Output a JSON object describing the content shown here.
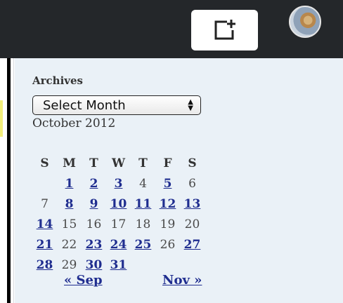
{
  "topbar": {
    "new_post_icon": "new-post-icon",
    "avatar_icon": "user-avatar"
  },
  "archives": {
    "title": "Archives",
    "select_value": "Select Month"
  },
  "calendar": {
    "caption": "October 2012",
    "weekdays": [
      "S",
      "M",
      "T",
      "W",
      "T",
      "F",
      "S"
    ],
    "rows": [
      [
        null,
        {
          "d": "1",
          "link": true
        },
        {
          "d": "2",
          "link": true
        },
        {
          "d": "3",
          "link": true
        },
        {
          "d": "4",
          "link": false
        },
        {
          "d": "5",
          "link": true
        },
        {
          "d": "6",
          "link": false
        }
      ],
      [
        {
          "d": "7",
          "link": false
        },
        {
          "d": "8",
          "link": true
        },
        {
          "d": "9",
          "link": true
        },
        {
          "d": "10",
          "link": true
        },
        {
          "d": "11",
          "link": true
        },
        {
          "d": "12",
          "link": true
        },
        {
          "d": "13",
          "link": true
        }
      ],
      [
        {
          "d": "14",
          "link": true
        },
        {
          "d": "15",
          "link": false
        },
        {
          "d": "16",
          "link": false
        },
        {
          "d": "17",
          "link": false
        },
        {
          "d": "18",
          "link": false
        },
        {
          "d": "19",
          "link": false
        },
        {
          "d": "20",
          "link": false
        }
      ],
      [
        {
          "d": "21",
          "link": true
        },
        {
          "d": "22",
          "link": false
        },
        {
          "d": "23",
          "link": true
        },
        {
          "d": "24",
          "link": true
        },
        {
          "d": "25",
          "link": true
        },
        {
          "d": "26",
          "link": false
        },
        {
          "d": "27",
          "link": true
        }
      ],
      [
        {
          "d": "28",
          "link": true
        },
        {
          "d": "29",
          "link": false
        },
        {
          "d": "30",
          "link": true
        },
        {
          "d": "31",
          "link": true
        },
        null,
        null,
        null
      ]
    ],
    "prev_label": "« Sep",
    "next_label": "Nov »"
  },
  "colors": {
    "topbar": "#24272a",
    "sidebar_bg": "#eaf1f7",
    "link": "#1f2d8f"
  }
}
